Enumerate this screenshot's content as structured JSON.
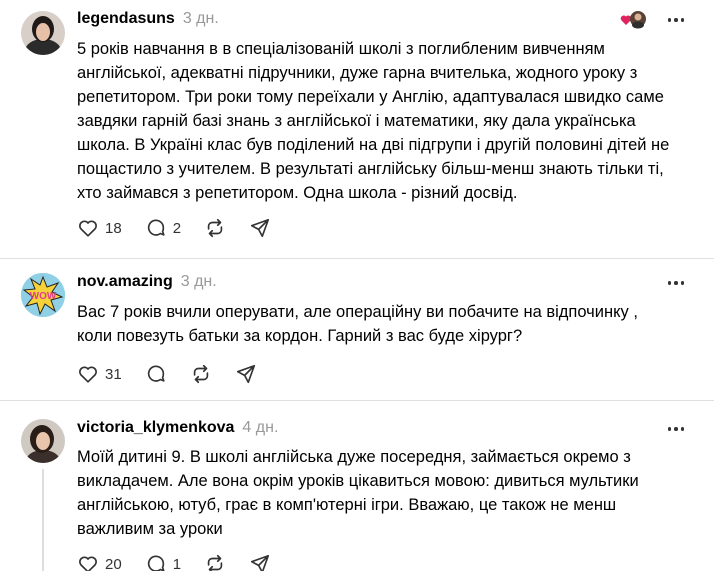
{
  "posts": [
    {
      "username": "legendasuns",
      "time": "3 дн.",
      "text": "5 років навчання в в спеціалізованій школі з поглибленим вивченням\nанглійської, адекватні підручники, дуже гарна вчителька, жодного уроку з\nрепетитором. Три роки тому переїхали у Англію, адаптувалася швидко саме\nзавдяки гарній базі знань з англійської і математики, яку дала українська\nшкола. В Україні клас був поділений на дві підгрупи і другій половині дітей не\nпощастило з учителем. В результаті англійську більш-менш знають тільки ті,\nхто займався з репетитором. Одна школа - різний досвід.",
      "likes": "18",
      "replies": "2",
      "reposts": "",
      "avatar_color": "#3a3a3a"
    },
    {
      "username": "nov.amazing",
      "time": "3 дн.",
      "text": "Вас 7 років вчили оперувати, але операційну ви побачите на відпочинку ,\nколи повезуть батьки за кордон. Гарний з вас буде хірург?",
      "likes": "31",
      "replies": "",
      "reposts": "",
      "avatar_text": "WOW"
    },
    {
      "username": "victoria_klymenkova",
      "time": "4 дн.",
      "text": "Моїй дитині 9. В школі англійська дуже посередня, займається окремо з\nвикладачем. Але вона окрім уроків цікавиться мовою: дивиться мультики\nанглійською, ютуб, грає в комп'ютерні ігри. Вважаю, це також не менш\nважливим за уроки",
      "likes": "20",
      "replies": "1",
      "reposts": ""
    }
  ],
  "colors": {
    "time": "#999999",
    "divider": "#e0e0e0",
    "icon": "#333333",
    "liked_heart": "#e0245e"
  }
}
